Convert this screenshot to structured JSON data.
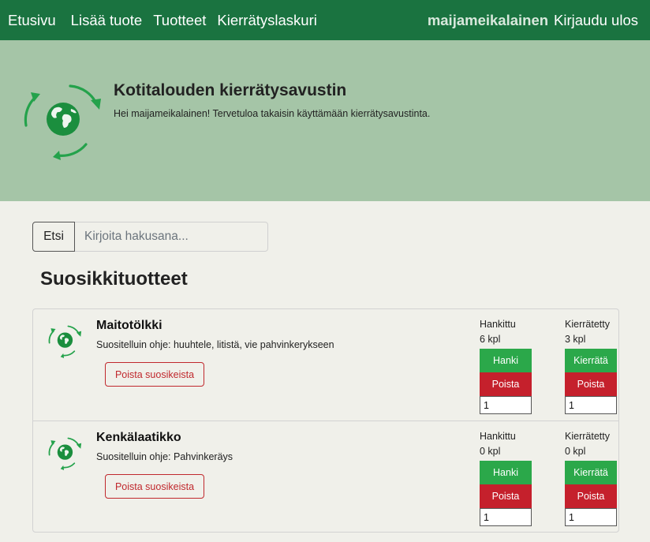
{
  "nav": {
    "links": [
      "Etusivu",
      "Lisää tuote",
      "Tuotteet",
      "Kierrätyslaskuri"
    ],
    "username": "maijameikalainen",
    "logout": "Kirjaudu ulos"
  },
  "hero": {
    "title": "Kotitalouden kierrätysavustin",
    "subtitle": "Hei maijameikalainen! Tervetuloa takaisin käyttämään kierrätysavustinta."
  },
  "search": {
    "button": "Etsi",
    "placeholder": "Kirjoita hakusana..."
  },
  "favorites": {
    "title": "Suosikkituotteet",
    "items": [
      {
        "name": "Maitotölkki",
        "instruction": "Suositelluin ohje: huuhtele, litistä, vie pahvinkerykseen",
        "remove": "Poista suosikeista",
        "acquired_label": "Hankittu",
        "acquired_value": "6 kpl",
        "recycled_label": "Kierrätetty",
        "recycled_value": "3 kpl",
        "acquire_button": "Hanki",
        "recycle_button": "Kierrätä",
        "delete_button": "Poista",
        "acquire_qty": "1",
        "recycle_qty": "1"
      },
      {
        "name": "Kenkälaatikko",
        "instruction": "Suositelluin ohje: Pahvinkeräys",
        "remove": "Poista suosikeista",
        "acquired_label": "Hankittu",
        "acquired_value": "0 kpl",
        "recycled_label": "Kierrätetty",
        "recycled_value": "0 kpl",
        "acquire_button": "Hanki",
        "recycle_button": "Kierrätä",
        "delete_button": "Poista",
        "acquire_qty": "1",
        "recycle_qty": "1"
      }
    ]
  },
  "colors": {
    "navbar": "#1a7340",
    "hero": "#a5c5a7",
    "background": "#f0f0ea",
    "green_button": "#2ba84a",
    "red_button": "#c5202c"
  },
  "icons": {
    "logo": "recycling-globe-icon"
  }
}
